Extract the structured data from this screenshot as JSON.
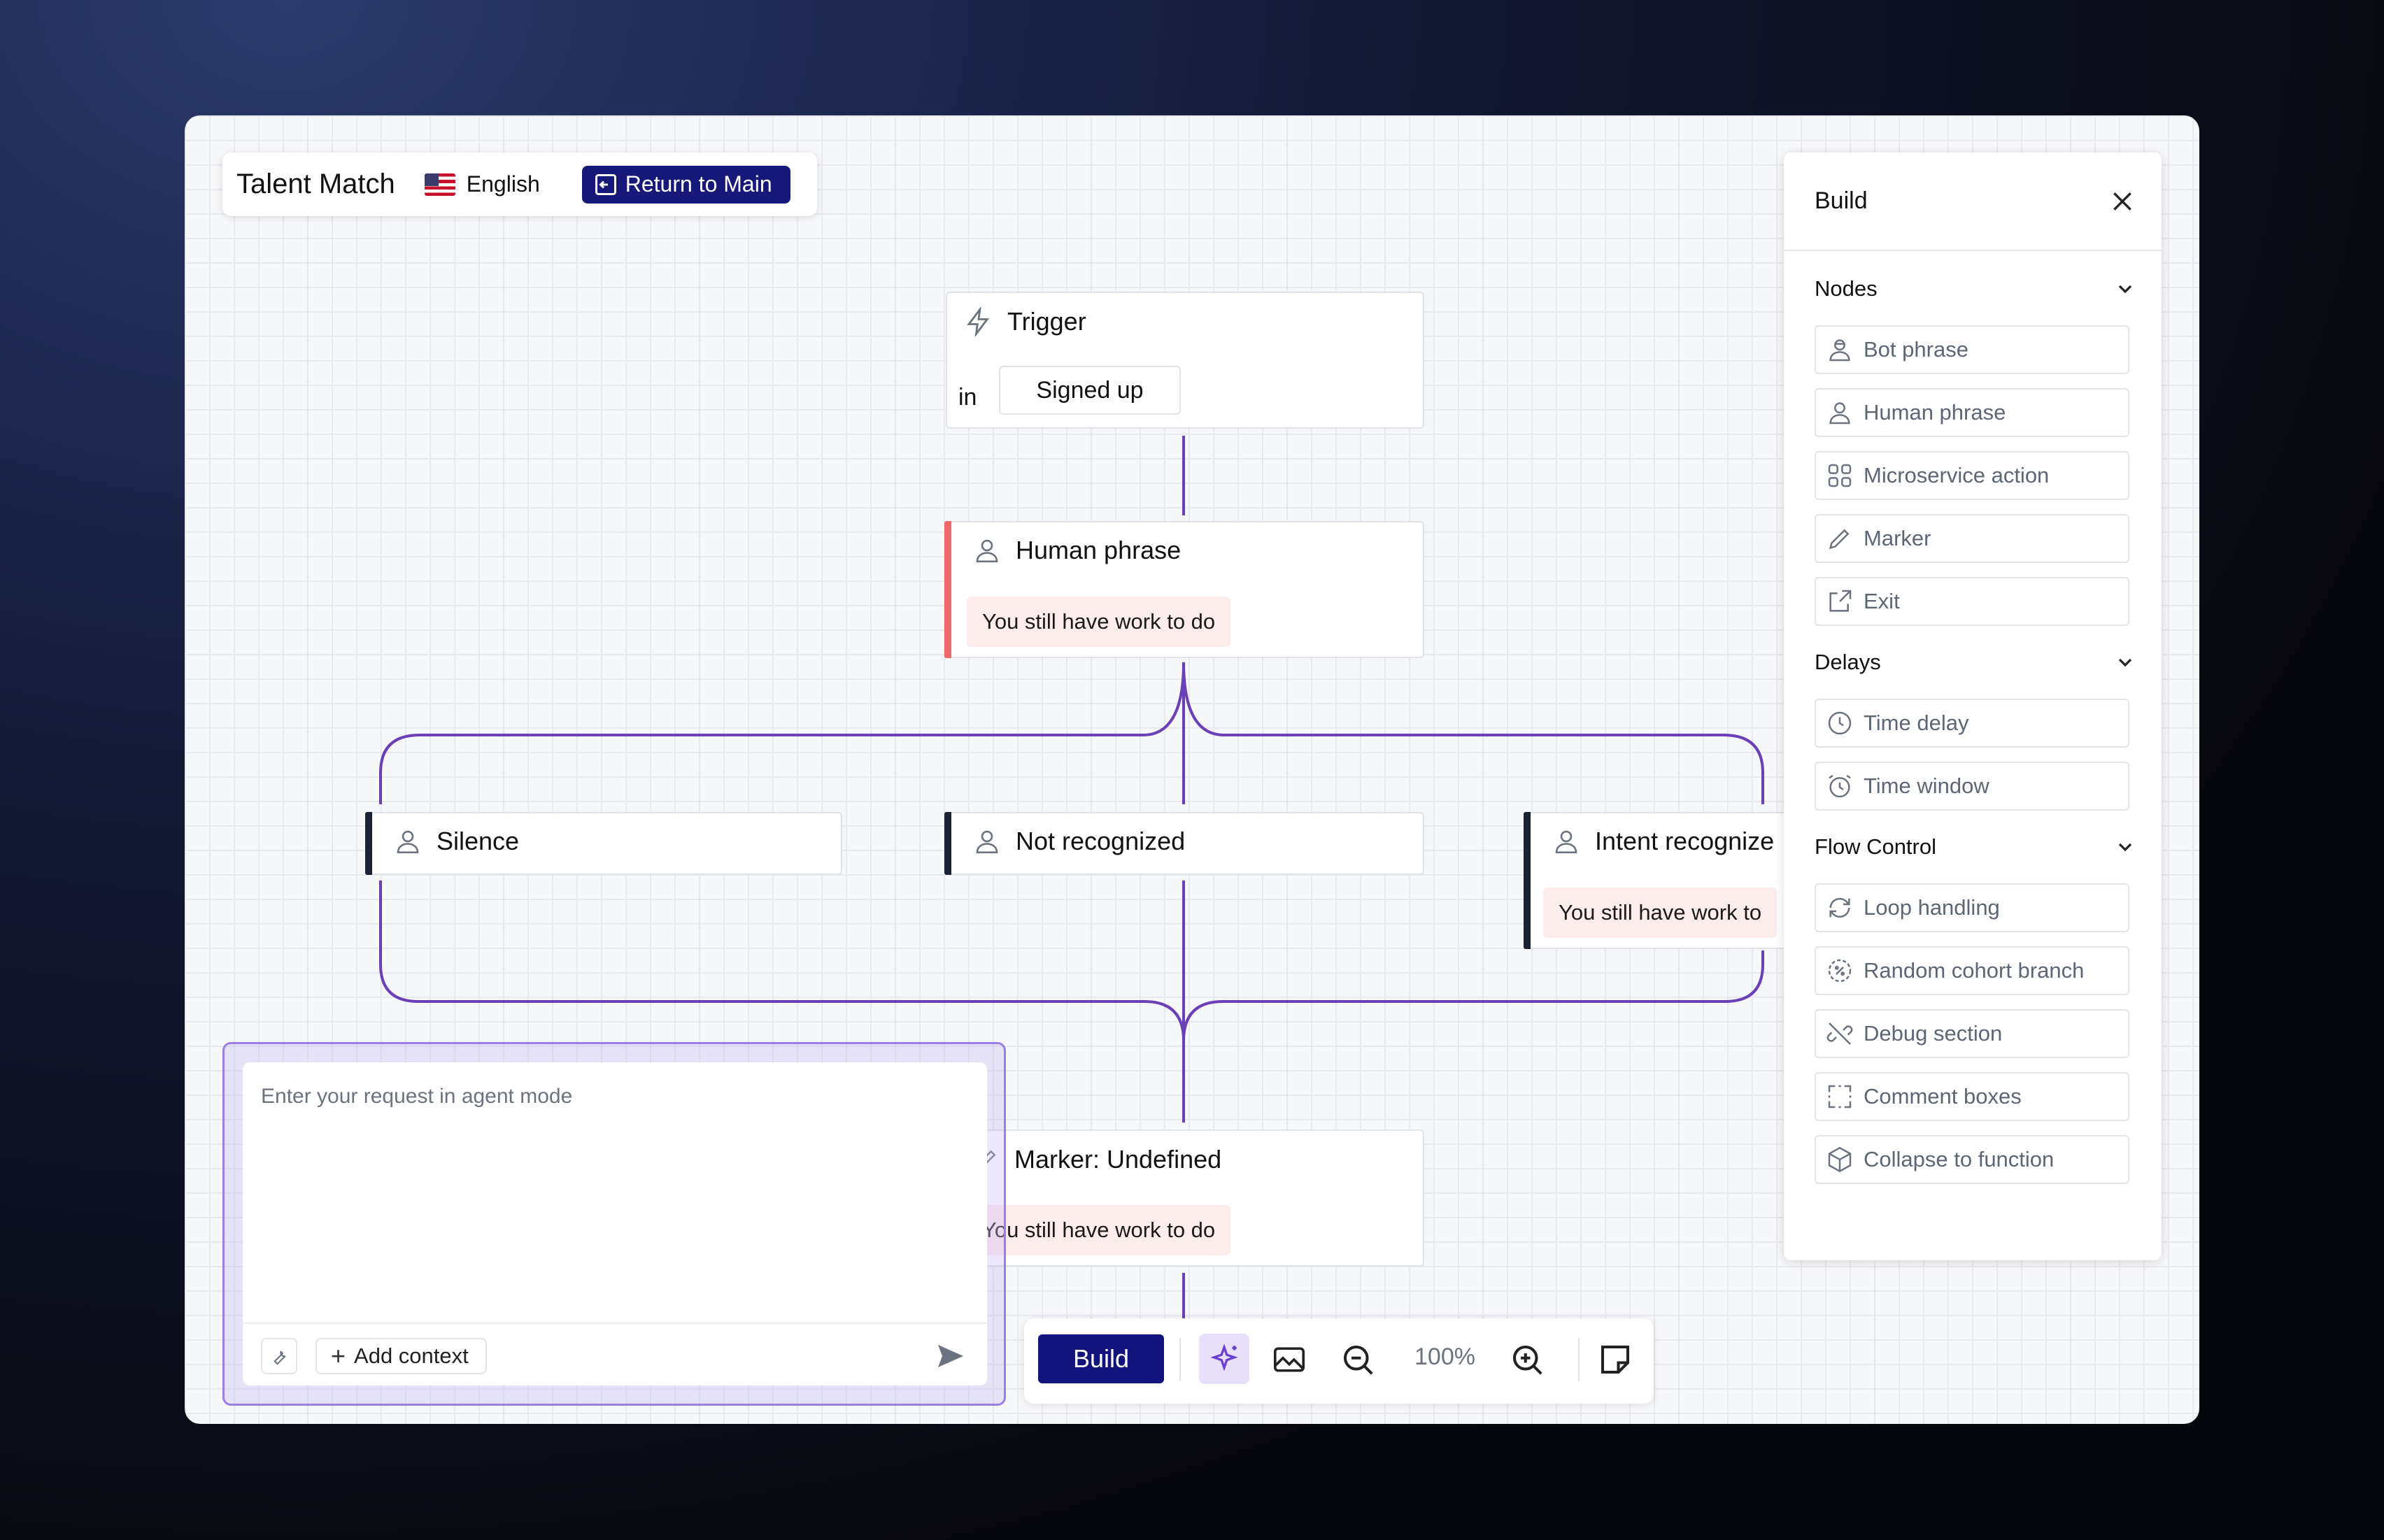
{
  "header": {
    "app_title": "Talent Match",
    "language": "English",
    "return_label": "Return to Main"
  },
  "canvas": {
    "trigger": {
      "title": "Trigger",
      "in_label": "in",
      "event": "Signed up"
    },
    "human_phrase": {
      "title": "Human phrase",
      "warning": "You still have work to do"
    },
    "branches": [
      {
        "title": "Silence"
      },
      {
        "title": "Not recognized"
      },
      {
        "title": "Intent recognize",
        "warning": "You still have work to"
      }
    ],
    "marker": {
      "title": "Marker: Undefined",
      "warning": "You still have work to do"
    },
    "connector_color": "#6b3fb8"
  },
  "build_panel": {
    "title": "Build",
    "sections": [
      {
        "title": "Nodes",
        "items": [
          "Bot phrase",
          "Human phrase",
          "Microservice action",
          "Marker",
          "Exit"
        ]
      },
      {
        "title": "Delays",
        "items": [
          "Time delay",
          "Time window"
        ]
      },
      {
        "title": "Flow Control",
        "items": [
          "Loop handling",
          "Random cohort branch",
          "Debug section",
          "Comment boxes",
          "Collapse to function"
        ]
      }
    ]
  },
  "agent": {
    "placeholder": "Enter your request in agent mode",
    "add_context": "Add context"
  },
  "toolbar": {
    "build_label": "Build",
    "zoom": "100%"
  },
  "colors": {
    "accent": "#13137e",
    "warning_bg": "#fdecec",
    "error_bar": "#ef6666",
    "agent_border": "#9b7fe6"
  }
}
